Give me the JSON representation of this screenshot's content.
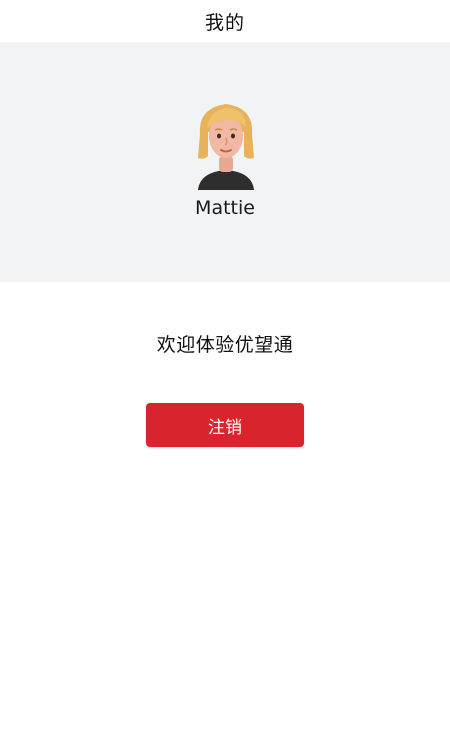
{
  "header": {
    "title": "我的"
  },
  "profile": {
    "username": "Mattie",
    "avatar_icon": "user-avatar-icon"
  },
  "main": {
    "welcome_text": "欢迎体验优望通",
    "logout_label": "注销"
  },
  "colors": {
    "profile_bg": "#f2f3f5",
    "logout_button": "#d8242c",
    "logout_text": "#ffffff"
  }
}
